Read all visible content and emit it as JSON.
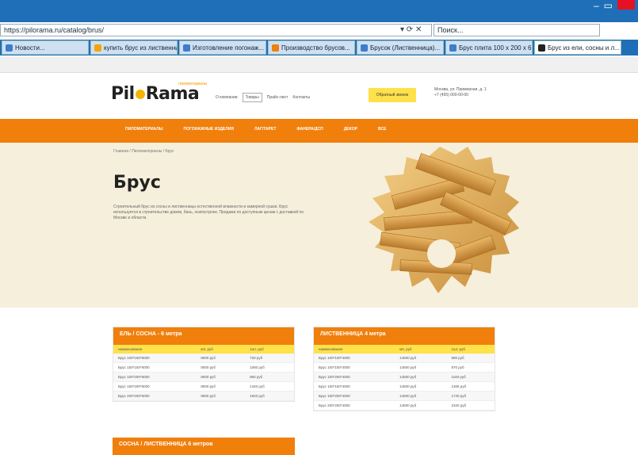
{
  "browser": {
    "address": "https://pilorama.ru/catalog/brus/",
    "search_placeholder": "Поиск...",
    "tabs": [
      {
        "label": "Новости...",
        "color": "#3d7dca"
      },
      {
        "label": "купить брус из лиственницы",
        "color": "#f5a400"
      },
      {
        "label": "Изготовление погонаж...",
        "color": "#3d7dca"
      },
      {
        "label": "Производство брусов...",
        "color": "#f07f0c"
      },
      {
        "label": "Брусок (Лиственница)...",
        "color": "#3d7dca"
      },
      {
        "label": "Брус плита 100 x 200 x 6...",
        "color": "#3d7dca"
      },
      {
        "label": "Брус из ели, сосны и л...",
        "color": "#222222",
        "active": true
      }
    ]
  },
  "site": {
    "logo": "Pil Rama",
    "logo_tagline": "пиломатериалы",
    "nav": [
      "О компании",
      "Товары",
      "Прайс-лист",
      "Контакты"
    ],
    "cta": "Обратный звонок",
    "contact_line1": "Москва, ул. Примерная, д. 1",
    "contact_line2": "+7 (495) 000-00-00",
    "menu": [
      "ПИЛОМАТЕРИАЛЫ",
      "ПОГОНАЖНЫЕ ИЗДЕЛИЯ",
      "ЛАГ/ТАРЕТ",
      "ФАНЕРА/ДСП",
      "ДЕКОР",
      "ВСЕ"
    ],
    "breadcrumbs": "Главная  /  Пиломатериалы  /  Брус",
    "title": "Брус",
    "description": "Строительный брус из сосны и лиственницы естественной влажности и камерной сушки. Брус используется в строительстве домов, бань, хозпостроек. Продажа по доступным ценам с доставкой по Москве и области."
  },
  "cards": [
    {
      "title": "ЕЛЬ / СОСНА - 6 метра",
      "headers": [
        "наименование",
        "м3, руб",
        "1шт, руб"
      ],
      "rows": [
        [
          "Брус 100*150*6000",
          "8000 руб",
          "720 руб"
        ],
        [
          "Брус 150*150*6000",
          "8000 руб",
          "1080 руб"
        ],
        [
          "Брус 100*200*6000",
          "8000 руб",
          "960 руб"
        ],
        [
          "Брус 150*200*6000",
          "8000 руб",
          "1440 руб"
        ],
        [
          "Брус 200*200*6000",
          "8000 руб",
          "1920 руб"
        ]
      ]
    },
    {
      "title": "ЛИСТВЕННИЦА 4 метра",
      "headers": [
        "наименование",
        "м3, руб",
        "1шт, руб"
      ],
      "rows": [
        [
          "Брус 100*100*4000",
          "14500 руб",
          "580 руб"
        ],
        [
          "Брус 100*150*4000",
          "14500 руб",
          "870 руб"
        ],
        [
          "Брус 100*200*4000",
          "14500 руб",
          "1160 руб"
        ],
        [
          "Брус 150*150*4000",
          "14500 руб",
          "1305 руб"
        ],
        [
          "Брус 150*200*4000",
          "14500 руб",
          "1740 руб"
        ],
        [
          "Брус 200*200*4000",
          "14500 руб",
          "2320 руб"
        ]
      ]
    },
    {
      "title": "СОСНА / ЛИСТВЕННИЦА 6 метров",
      "headers": [],
      "rows": []
    }
  ]
}
